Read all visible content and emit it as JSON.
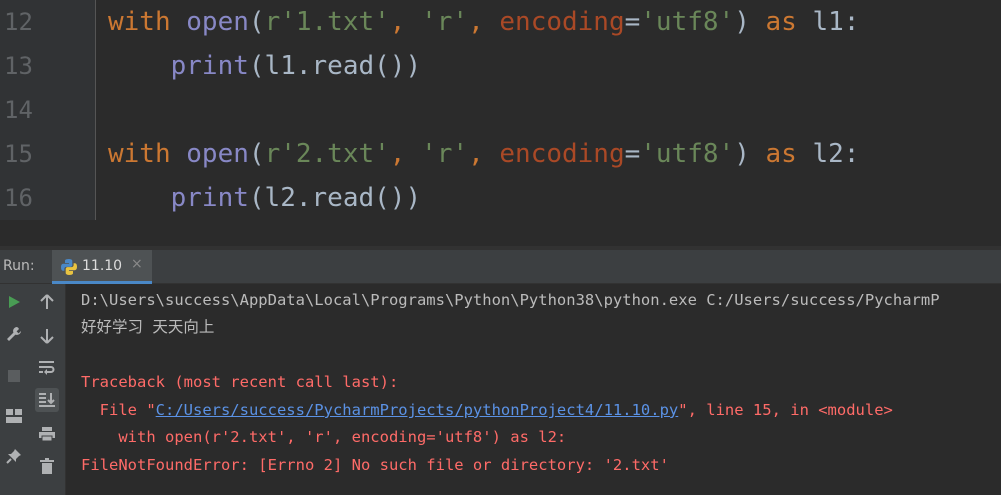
{
  "editor": {
    "line_numbers": [
      "12",
      "13",
      "14",
      "15",
      "16"
    ],
    "lines": [
      [
        {
          "t": "with",
          "c": "kw"
        },
        {
          "t": " ",
          "c": "plain"
        },
        {
          "t": "open",
          "c": "bi"
        },
        {
          "t": "(",
          "c": "plain"
        },
        {
          "t": "r'1.txt'",
          "c": "str"
        },
        {
          "t": ", ",
          "c": "kw"
        },
        {
          "t": "'r'",
          "c": "str"
        },
        {
          "t": ", ",
          "c": "kw"
        },
        {
          "t": "encoding",
          "c": "param"
        },
        {
          "t": "=",
          "c": "plain"
        },
        {
          "t": "'utf8'",
          "c": "str"
        },
        {
          "t": ") ",
          "c": "plain"
        },
        {
          "t": "as",
          "c": "kw"
        },
        {
          "t": " l1:",
          "c": "plain"
        }
      ],
      [
        {
          "t": "    ",
          "c": "plain"
        },
        {
          "t": "print",
          "c": "bi"
        },
        {
          "t": "(l1.read())",
          "c": "plain"
        }
      ],
      [],
      [
        {
          "t": "with",
          "c": "kw"
        },
        {
          "t": " ",
          "c": "plain"
        },
        {
          "t": "open",
          "c": "bi"
        },
        {
          "t": "(",
          "c": "plain"
        },
        {
          "t": "r'2.txt'",
          "c": "str"
        },
        {
          "t": ", ",
          "c": "kw"
        },
        {
          "t": "'r'",
          "c": "str"
        },
        {
          "t": ", ",
          "c": "kw"
        },
        {
          "t": "encoding",
          "c": "param"
        },
        {
          "t": "=",
          "c": "plain"
        },
        {
          "t": "'utf8'",
          "c": "str"
        },
        {
          "t": ") ",
          "c": "plain"
        },
        {
          "t": "as",
          "c": "kw"
        },
        {
          "t": " l2:",
          "c": "plain"
        }
      ],
      [
        {
          "t": "    ",
          "c": "plain"
        },
        {
          "t": "print",
          "c": "bi"
        },
        {
          "t": "(l2.read())",
          "c": "plain"
        }
      ]
    ]
  },
  "run_panel": {
    "label": "Run:",
    "tab_label": "11.10",
    "tab_close": "×"
  },
  "console": {
    "command": "D:\\Users\\success\\AppData\\Local\\Programs\\Python\\Python38\\python.exe C:/Users/success/PycharmP",
    "output": "好好学习 天天向上",
    "traceback_header": "Traceback (most recent call last):",
    "file_prefix": "  File \"",
    "file_link": "C:/Users/success/PycharmProjects/pythonProject4/11.10.py",
    "file_suffix": "\", line 15, in <module>",
    "source_line": "    with open(r'2.txt', 'r', encoding='utf8') as l2:",
    "error": "FileNotFoundError: [Errno 2] No such file or directory: '2.txt'"
  },
  "colors": {
    "keyword": "#cc7832",
    "builtin": "#8888c6",
    "string": "#6a8759",
    "param": "#aa4926",
    "error": "#ff6b68",
    "link": "#5b92e5",
    "run_green": "#499c54"
  },
  "toolbar_icons": {
    "left": [
      "run-icon",
      "wrench-icon",
      "stop-icon",
      "layout-icon",
      "pin-icon"
    ],
    "right": [
      "up-arrow-icon",
      "down-arrow-icon",
      "soft-wrap-icon",
      "scroll-to-end-icon",
      "print-icon",
      "trash-icon"
    ]
  }
}
